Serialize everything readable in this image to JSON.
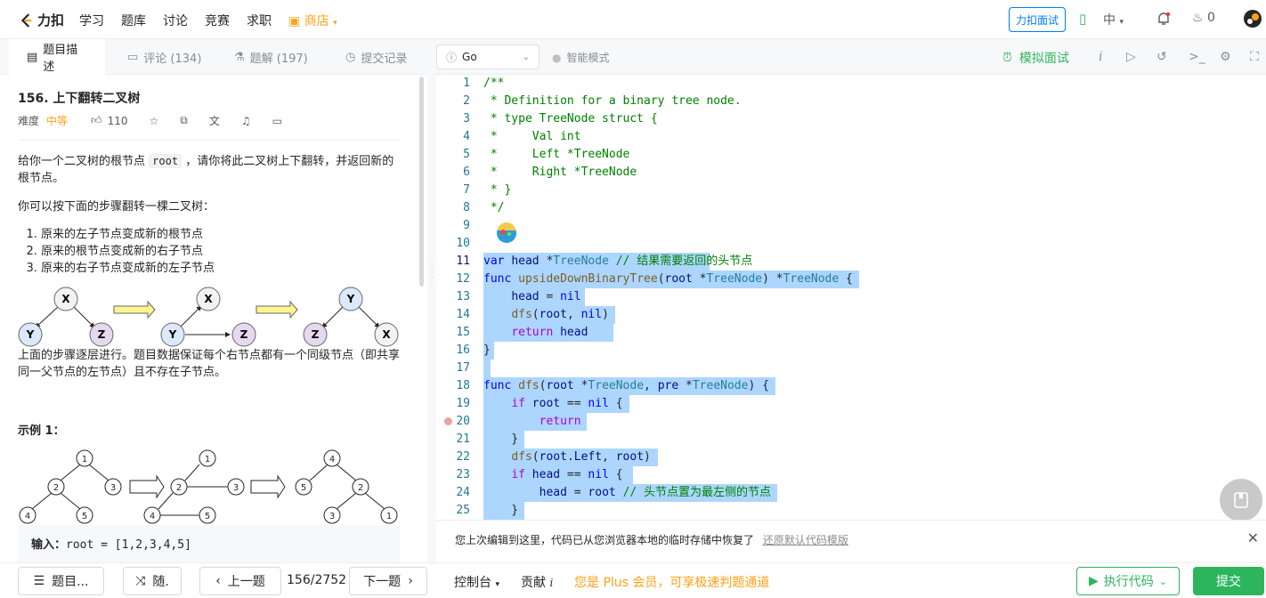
{
  "nav": {
    "logo": "力扣",
    "items": [
      "学习",
      "题库",
      "讨论",
      "竞赛",
      "求职"
    ],
    "shop": "商店",
    "interview_btn": "力扣面试",
    "lang": "中",
    "points": "0"
  },
  "left_tabs": {
    "description": "题目描述",
    "comments": "评论 (134)",
    "solutions": "题解 (197)",
    "submissions": "提交记录"
  },
  "problem": {
    "title": "156. 上下翻转二叉树",
    "difficulty_label": "难度",
    "difficulty": "中等",
    "likes": "110",
    "p1_a": "给你一个二叉树的根节点",
    "p1_code": "root",
    "p1_b": "，请你将此二叉树上下翻转，并返回新的根节点。",
    "p2": "你可以按下面的步骤翻转一棵二叉树：",
    "steps": [
      "原来的左子节点变成新的根节点",
      "原来的根节点变成新的右子节点",
      "原来的右子节点变成新的左子节点"
    ],
    "p3": "上面的步骤逐层进行。题目数据保证每个右节点都有一个同级节点（即共享同一父节点的左节点）且不存在子节点。",
    "example_title": "示例 1：",
    "example_input_label": "输入：",
    "example_input": "root = [1,2,3,4,5]"
  },
  "figure1": {
    "nodes": [
      "X",
      "Y",
      "Z"
    ]
  },
  "figure2": {
    "nodes": [
      "1",
      "2",
      "3",
      "4",
      "5"
    ]
  },
  "editor": {
    "language": "Go",
    "smart_mode": "智能模式",
    "mock_interview": "模拟面试",
    "line_numbers": [
      "1",
      "2",
      "3",
      "4",
      "5",
      "6",
      "7",
      "8",
      "9",
      "10",
      "11",
      "12",
      "13",
      "14",
      "15",
      "16",
      "17",
      "18",
      "19",
      "20",
      "21",
      "22",
      "23",
      "24",
      "25"
    ]
  },
  "notice": {
    "text": "您上次编辑到这里，代码已从您浏览器本地的临时存储中恢复了",
    "link": "还原默认代码模版"
  },
  "bottom": {
    "problem_list": "题目...",
    "random": "随.",
    "prev": "上一题",
    "counter": "156/2752",
    "next": "下一题",
    "console": "控制台",
    "contribute": "贡献",
    "plus_text": "您是 Plus 会员，可享极速判题通道",
    "run": "执行代码",
    "submit": "提交"
  },
  "colors": {
    "accent_green": "#2db55d",
    "accent_orange": "#ffa116",
    "selection": "#add6ff"
  }
}
